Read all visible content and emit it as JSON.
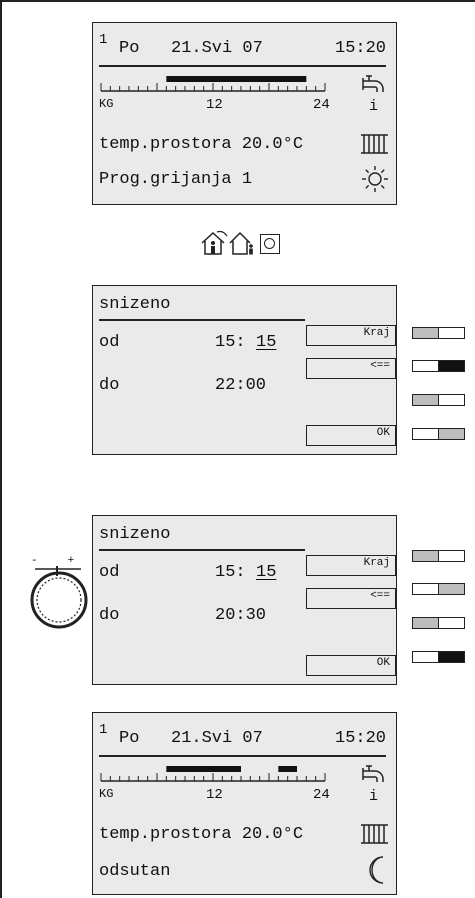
{
  "screen1": {
    "circuit": "1",
    "day": "Po",
    "date": "21.Svi 07",
    "time": "15:20",
    "scale": {
      "start": "KG",
      "mid": "12",
      "end": "24"
    },
    "info": "i",
    "temperature_line": "temp.prostora 20.0°C",
    "program_line": "Prog.grijanja 1",
    "program_bars": [
      [
        7,
        22
      ]
    ]
  },
  "mode_icons": [
    "house-occupants-icon",
    "house-person-icon",
    "round-button-icon"
  ],
  "screen2": {
    "title": "snizeno",
    "from_label": "od",
    "from_time_hour": "15:",
    "from_time_min": "15",
    "to_label": "do",
    "to_time": "22:00",
    "buttons": {
      "end": "Kraj",
      "back": "<==",
      "ok": "OK"
    },
    "keys": [
      [
        "gray",
        "white"
      ],
      [
        "white",
        "black"
      ],
      [
        "gray",
        "white"
      ],
      [
        "white",
        "gray"
      ]
    ]
  },
  "screen3": {
    "title": "snizeno",
    "from_label": "od",
    "from_time_hour": "15:",
    "from_time_min": "15",
    "to_label": "do",
    "to_time": "20:30",
    "buttons": {
      "end": "Kraj",
      "back": "<==",
      "ok": "OK"
    },
    "keys": [
      [
        "gray",
        "white"
      ],
      [
        "white",
        "gray"
      ],
      [
        "gray",
        "white"
      ],
      [
        "white",
        "black"
      ]
    ],
    "knob_label": "-+"
  },
  "screen4": {
    "circuit": "1",
    "day": "Po",
    "date": "21.Svi 07",
    "time": "15:20",
    "scale": {
      "start": "KG",
      "mid": "12",
      "end": "24"
    },
    "info": "i",
    "temperature_line": "temp.prostora 20.0°C",
    "status_line": "odsutan",
    "program_bars": [
      [
        7,
        15
      ],
      [
        19,
        21
      ]
    ]
  }
}
